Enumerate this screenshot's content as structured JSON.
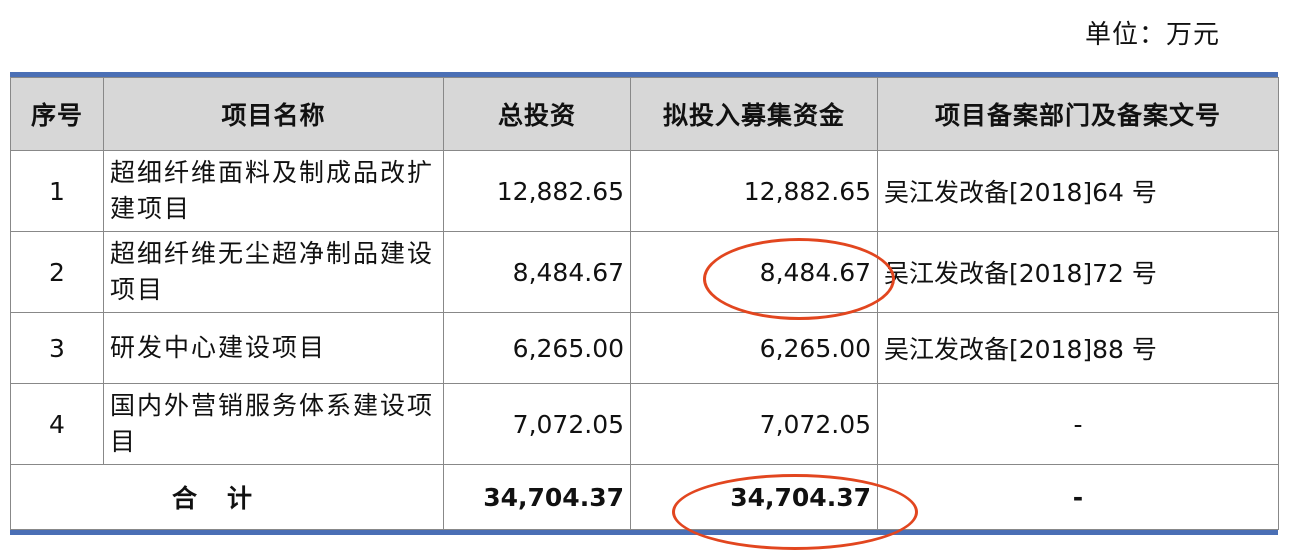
{
  "unit_label": "单位：万元",
  "headers": [
    "序号",
    "项目名称",
    "总投资",
    "拟投入募集资金",
    "项目备案部门及备案文号"
  ],
  "rows": [
    {
      "seq": "1",
      "name": "超细纤维面料及制成品改扩建项目",
      "total": "12,882.65",
      "raised": "12,882.65",
      "filing": "吴江发改备[2018]64 号"
    },
    {
      "seq": "2",
      "name": "超细纤维无尘超净制品建设项目",
      "total": "8,484.67",
      "raised": "8,484.67",
      "filing": "吴江发改备[2018]72 号"
    },
    {
      "seq": "3",
      "name": "研发中心建设项目",
      "total": "6,265.00",
      "raised": "6,265.00",
      "filing": "吴江发改备[2018]88 号"
    },
    {
      "seq": "4",
      "name": "国内外营销服务体系建设项目",
      "total": "7,072.05",
      "raised": "7,072.05",
      "filing": "-"
    }
  ],
  "total_row": {
    "label": "合计",
    "total": "34,704.37",
    "raised": "34,704.37",
    "filing": "-"
  },
  "colors": {
    "header_bg": "#d7d7d7",
    "rule_blue": "#4a6fb5",
    "highlight_red": "#e2461f"
  }
}
